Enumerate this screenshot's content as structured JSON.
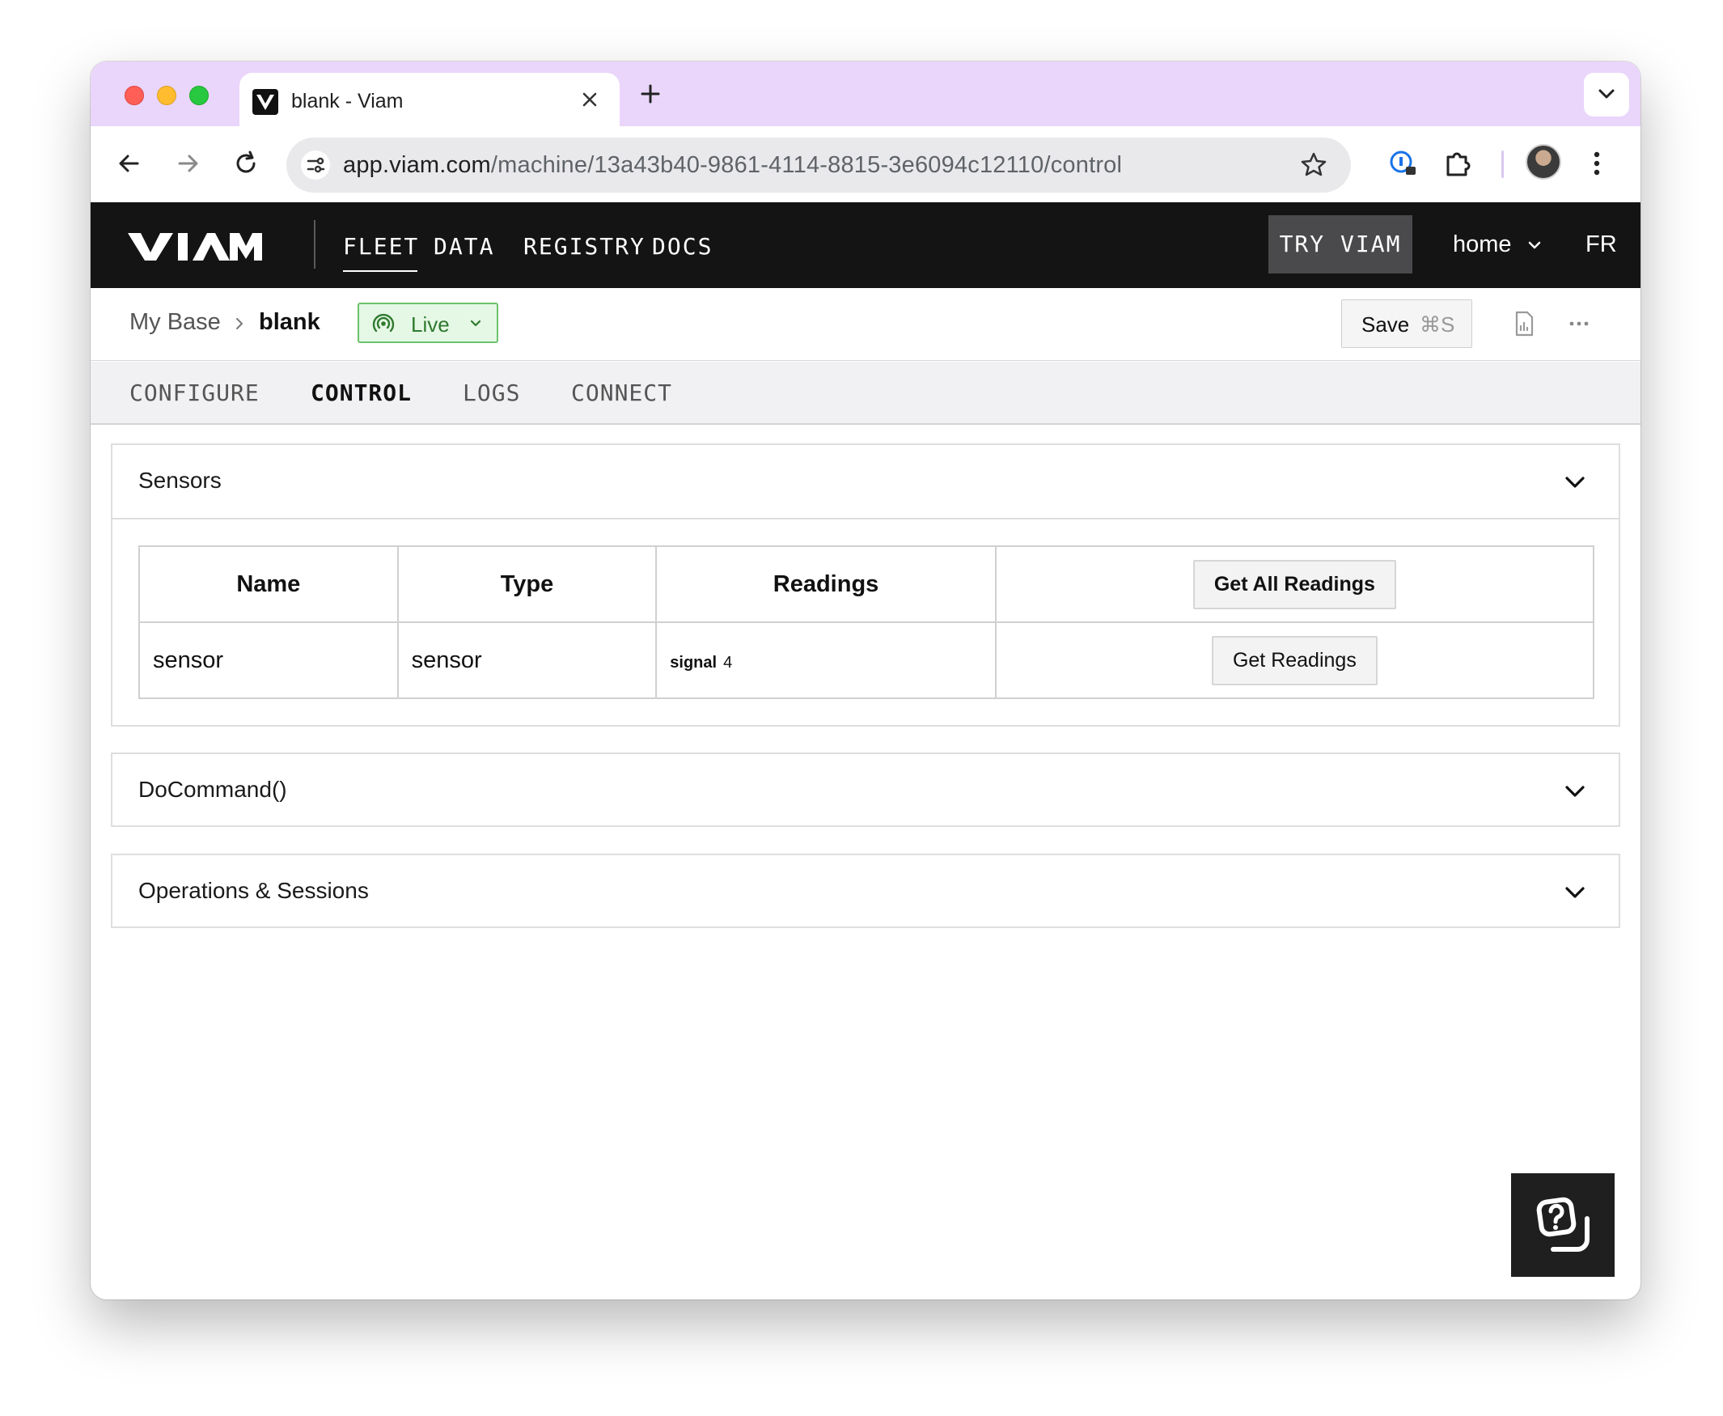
{
  "browser": {
    "tab_title": "blank - Viam",
    "url_domain": "app.viam.com",
    "url_path": "/machine/13a43b40-9861-4114-8815-3e6094c12110/control"
  },
  "nav": {
    "links": [
      "FLEET",
      "DATA",
      "REGISTRY",
      "DOCS"
    ],
    "active": "FLEET",
    "try_label": "TRY VIAM",
    "org": "home",
    "user_initials": "FR"
  },
  "breadcrumb": {
    "parent": "My Base",
    "current": "blank",
    "status": "Live"
  },
  "actions": {
    "save_label": "Save",
    "save_shortcut": "⌘S"
  },
  "tabs": {
    "items": [
      "CONFIGURE",
      "CONTROL",
      "LOGS",
      "CONNECT"
    ],
    "active": "CONTROL"
  },
  "sensors": {
    "title": "Sensors",
    "columns": [
      "Name",
      "Type",
      "Readings"
    ],
    "get_all_label": "Get All Readings",
    "rows": [
      {
        "name": "sensor",
        "type": "sensor",
        "reading_key": "signal",
        "reading_value": "4",
        "button": "Get Readings"
      }
    ]
  },
  "panels": {
    "docommand": "DoCommand()",
    "operations": "Operations & Sessions"
  },
  "colors": {
    "tabstrip": "#ead5fb",
    "appbar": "#141414",
    "live_bg": "#e5f7e5",
    "live_border": "#6cc26c"
  }
}
